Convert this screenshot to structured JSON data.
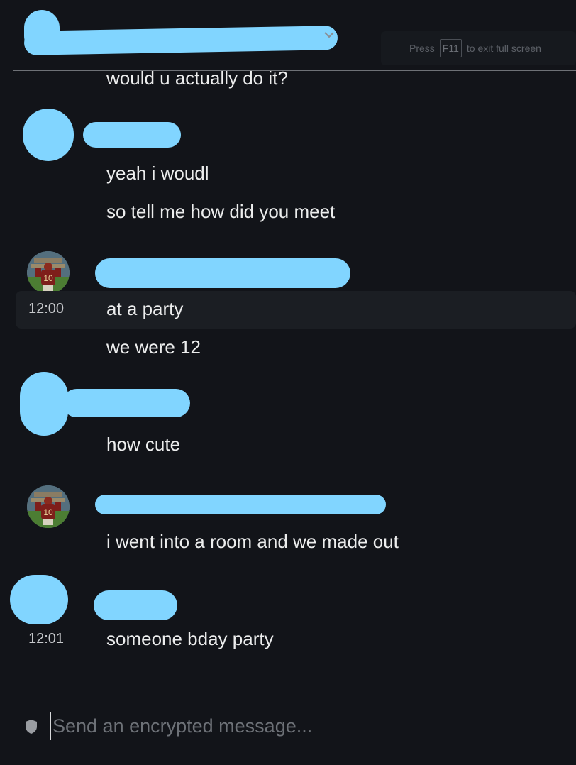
{
  "fullscreen_notice": {
    "press": "Press",
    "key": "F11",
    "rest": "to exit full screen"
  },
  "messages": {
    "m0": "would u actually do it?",
    "m1": "yeah i woudl",
    "m2": "so tell me how did you meet",
    "m3": "at a party",
    "m4": "we were 12",
    "m5": "how cute",
    "m6": "i went into a room and we made out",
    "m7": "someone bday party"
  },
  "timestamps": {
    "t3": "12:00",
    "t7": "12:01"
  },
  "composer": {
    "placeholder": "Send an encrypted message..."
  },
  "icons": {
    "shield": "shield-icon",
    "chevron": "chevron-down-icon"
  },
  "colors": {
    "background": "#121419",
    "redaction": "#81d5ff",
    "text": "#eceded",
    "hover": "#1b1e23"
  }
}
